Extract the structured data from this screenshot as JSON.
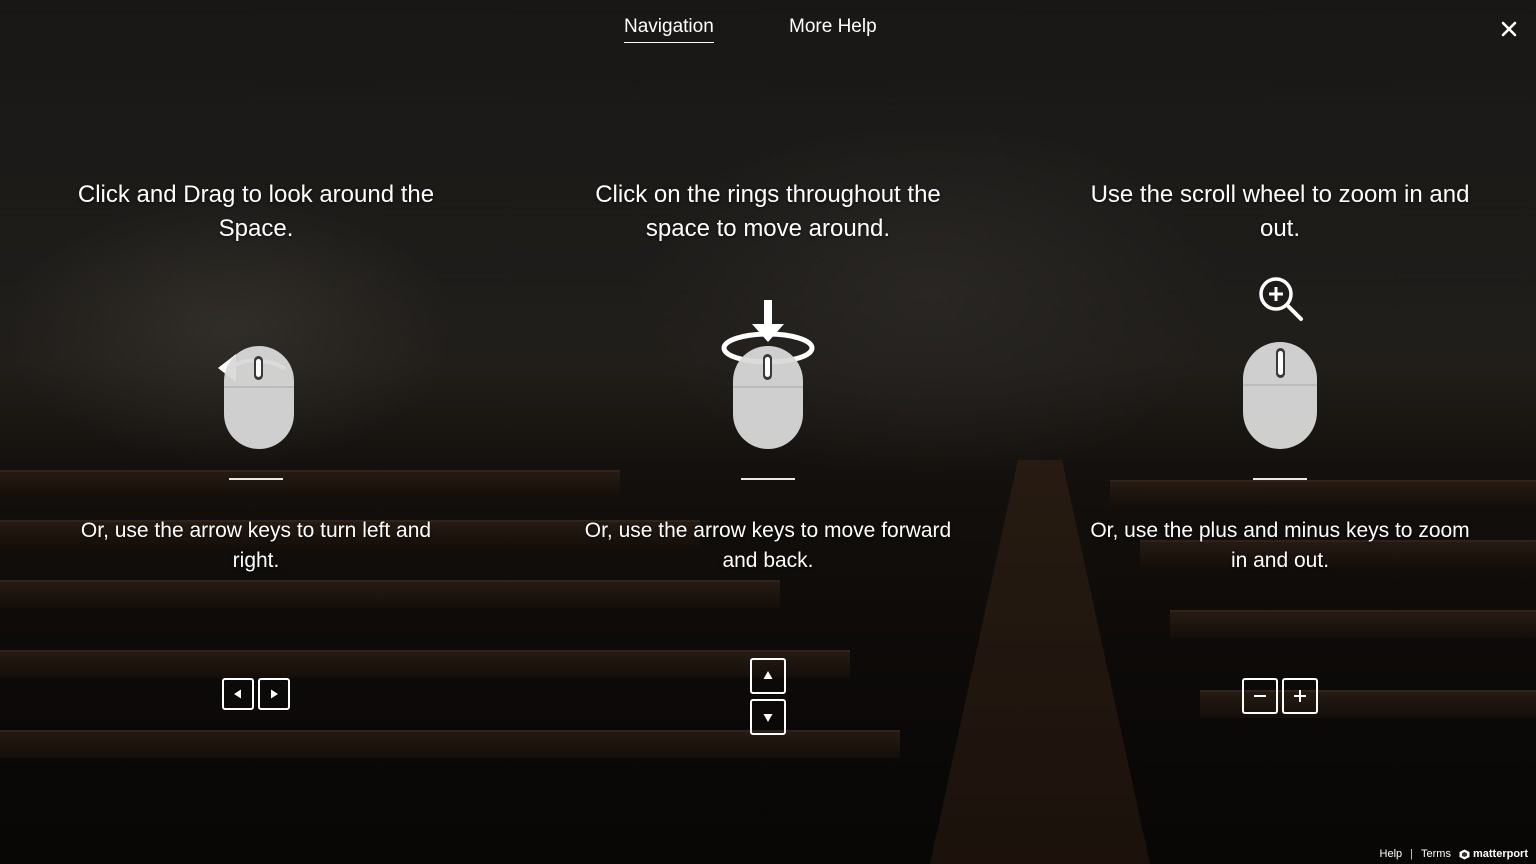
{
  "tabs": [
    {
      "label": "Navigation",
      "active": true
    },
    {
      "label": "More Help",
      "active": false
    }
  ],
  "columns": [
    {
      "heading": "Click and Drag to look around the Space.",
      "keyboard_text": "Or, use the arrow keys to turn left and right.",
      "keys": [
        "left-arrow-key",
        "right-arrow-key"
      ]
    },
    {
      "heading": "Click on the rings throughout the space to move around.",
      "keyboard_text": "Or, use the arrow keys to move forward and back.",
      "keys": [
        "up-arrow-key",
        "down-arrow-key"
      ]
    },
    {
      "heading": "Use the scroll wheel to zoom in and out.",
      "keyboard_text": "Or, use the plus and minus keys to zoom in and out.",
      "keys": [
        "minus-key",
        "plus-key"
      ]
    }
  ],
  "footer": {
    "help": "Help",
    "separator": "|",
    "terms": "Terms",
    "brand": "matterport"
  },
  "colors": {
    "overlay": "#000000",
    "text": "#ffffff",
    "mouse_body": "#d9d9d9"
  }
}
